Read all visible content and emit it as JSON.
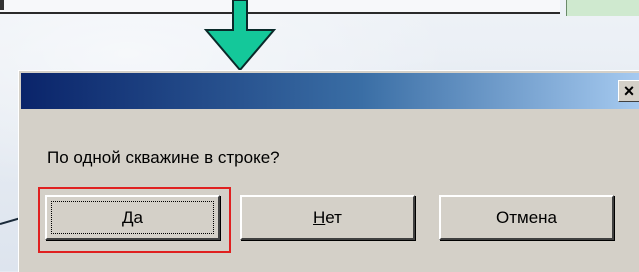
{
  "dialog": {
    "close_glyph": "×",
    "message": "По одной скважине в строке?",
    "buttons": {
      "yes": "Да",
      "no": "Нет",
      "cancel": "Отмена"
    }
  },
  "colors": {
    "titlebar_start": "#0a246a",
    "titlebar_end": "#a6caf0",
    "dialog_face": "#d4d0c8",
    "arrow_fill": "#14c89a",
    "highlight": "#e02020"
  },
  "icons": {
    "annotation_arrow_down": "down-arrow-icon",
    "annotation_pointer": "pointer-arrow-icon",
    "close": "close-icon"
  }
}
